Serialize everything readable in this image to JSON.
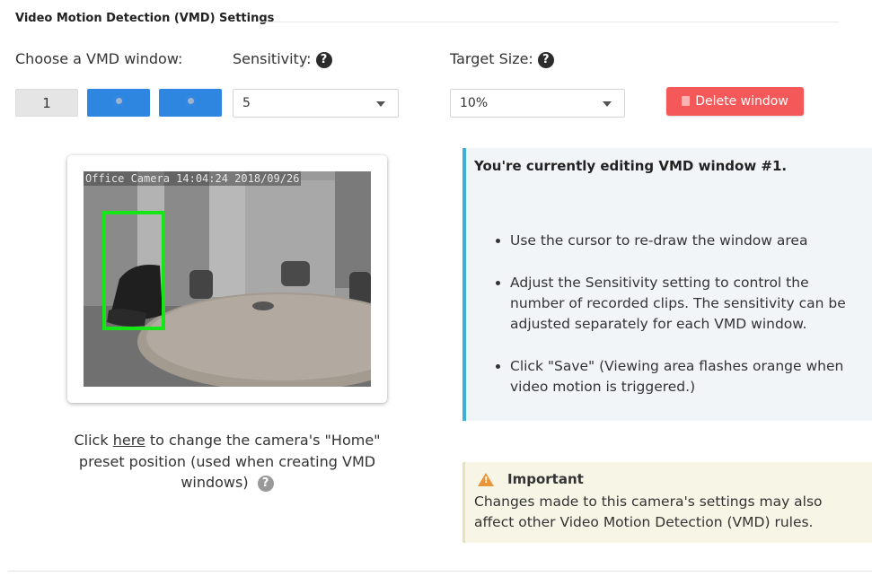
{
  "section": {
    "title": "Video Motion Detection (VMD) Settings"
  },
  "controls": {
    "window_label": "Choose a VMD window:",
    "sensitivity_label": "Sensitivity:",
    "target_size_label": "Target Size:",
    "windows": [
      {
        "label": "1",
        "state": "current"
      },
      {
        "label": "",
        "state": "add",
        "icon": "gear-icon"
      },
      {
        "label": "",
        "state": "add",
        "icon": "gear-icon"
      }
    ],
    "sensitivity_value": "5",
    "target_size_value": "10%",
    "delete_label": "Delete window"
  },
  "camera": {
    "osd_text": "Office Camera 14:04:24 2018/09/26",
    "vmd_window_color": "#16e516"
  },
  "home_preset": {
    "before": "Click ",
    "link": "here",
    "after": " to change the camera's \"Home\" preset position (used when creating VMD windows)"
  },
  "info": {
    "heading": "You're currently editing VMD window #1.",
    "items": [
      "Use the cursor to re-draw the window area",
      "Adjust the Sensitivity setting to control the number of recorded clips. The sensitivity can be adjusted separately for each VMD window.",
      "Click \"Save\" (Viewing area flashes orange when video motion is triggered.)"
    ]
  },
  "important": {
    "title": "Important",
    "text": "Changes made to this camera's settings may also affect other Video Motion Detection (VMD) rules."
  },
  "colors": {
    "accent_blue": "#2f86e0",
    "delete_red": "#f45858",
    "info_border": "#3db0d8",
    "warning_orange": "#e9953a"
  }
}
